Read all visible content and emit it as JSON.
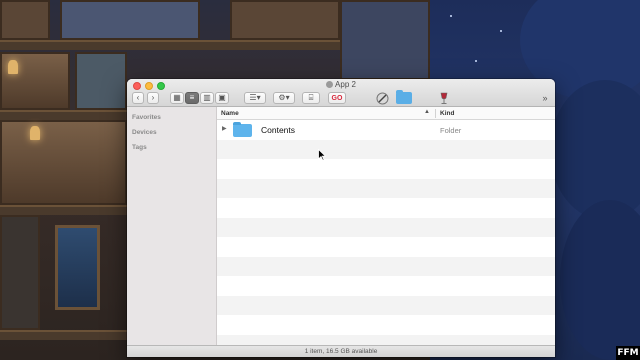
{
  "window": {
    "title": "App 2",
    "toolbar": {
      "back_icon": "chevron-left-icon",
      "forward_icon": "chevron-right-icon",
      "view_modes": [
        "icon-view",
        "list-view",
        "column-view",
        "cover-flow-view"
      ],
      "active_view": "list-view",
      "go_label": "GO",
      "overflow_label": "»"
    }
  },
  "sidebar": {
    "sections": [
      {
        "label": "Favorites"
      },
      {
        "label": "Devices"
      },
      {
        "label": "Tags"
      }
    ]
  },
  "list": {
    "columns": {
      "name": "Name",
      "kind": "Kind",
      "sort_indicator": "▲"
    },
    "items": [
      {
        "name": "Contents",
        "kind": "Folder",
        "disclosure": "▶",
        "icon": "folder-icon"
      }
    ]
  },
  "status": {
    "text": "1 item, 16.5 GB available"
  },
  "desktop": {
    "badge": "FFM"
  },
  "colors": {
    "folder": "#5eb4ec",
    "close": "#fc605b",
    "minimize": "#fdbc40",
    "zoom": "#34c84a",
    "go": "#d8263a"
  }
}
